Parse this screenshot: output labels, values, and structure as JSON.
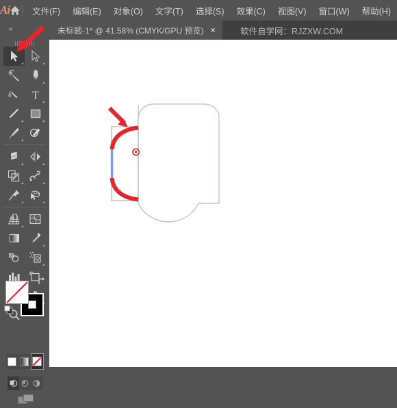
{
  "app": {
    "logo_text": "Ai",
    "home_icon": "home-icon"
  },
  "menubar": {
    "items": [
      {
        "label": "文件(F)",
        "name": "menu-file"
      },
      {
        "label": "编辑(E)",
        "name": "menu-edit"
      },
      {
        "label": "对象(O)",
        "name": "menu-object"
      },
      {
        "label": "文字(T)",
        "name": "menu-type"
      },
      {
        "label": "选择(S)",
        "name": "menu-select"
      },
      {
        "label": "效果(C)",
        "name": "menu-effect"
      },
      {
        "label": "视图(V)",
        "name": "menu-view"
      },
      {
        "label": "窗口(W)",
        "name": "menu-window"
      },
      {
        "label": "帮助(H)",
        "name": "menu-help"
      }
    ]
  },
  "tabbar": {
    "collapse_icon": "«",
    "tab_title": "未标题-1* @ 41.58% (CMYK/GPU 预览)",
    "close_label": "×",
    "watermark": "软件自学网：RJZXW.COM"
  },
  "toolpanel": {
    "tools": [
      {
        "label": "选择工具",
        "name": "tool-selection",
        "icon": "selection-arrow-icon",
        "active": true,
        "has_flyout": true
      },
      {
        "label": "直接选择工具",
        "name": "tool-direct-selection",
        "icon": "direct-selection-arrow-icon",
        "active": false,
        "has_flyout": true
      },
      {
        "label": "魔棒工具",
        "name": "tool-magic-wand",
        "icon": "magic-wand-icon",
        "active": false,
        "has_flyout": false
      },
      {
        "label": "钢笔工具",
        "name": "tool-pen",
        "icon": "pen-icon",
        "active": false,
        "has_flyout": true
      },
      {
        "label": "曲率工具",
        "name": "tool-curvature",
        "icon": "curvature-icon",
        "active": false,
        "has_flyout": false
      },
      {
        "label": "文字工具",
        "name": "tool-type",
        "icon": "type-t-icon",
        "active": false,
        "has_flyout": true
      },
      {
        "label": "直线段工具",
        "name": "tool-line-segment",
        "icon": "line-segment-icon",
        "active": false,
        "has_flyout": true
      },
      {
        "label": "矩形工具",
        "name": "tool-rectangle",
        "icon": "rectangle-icon",
        "active": false,
        "has_flyout": true
      },
      {
        "label": "画笔工具",
        "name": "tool-paintbrush",
        "icon": "paintbrush-icon",
        "active": false,
        "has_flyout": true
      },
      {
        "label": "斑点画笔工具",
        "name": "tool-blob-brush",
        "icon": "blob-brush-icon",
        "active": false,
        "has_flyout": false
      },
      {
        "label": "橡皮擦工具",
        "name": "tool-eraser",
        "icon": "eraser-icon",
        "active": false,
        "has_flyout": true
      },
      {
        "label": "旋转工具",
        "name": "tool-rotate-reflect",
        "icon": "reflect-icon",
        "active": false,
        "has_flyout": true
      },
      {
        "label": "比例缩放工具",
        "name": "tool-scale",
        "icon": "scale-icon",
        "active": false,
        "has_flyout": true
      },
      {
        "label": "宽度工具",
        "name": "tool-width-warp",
        "icon": "warp-icon",
        "active": false,
        "has_flyout": true
      },
      {
        "label": "自由变换工具",
        "name": "tool-free-transform",
        "icon": "free-transform-pin-icon",
        "active": false,
        "has_flyout": true
      },
      {
        "label": "形状生成器工具",
        "name": "tool-shape-builder",
        "icon": "shape-builder-icon",
        "active": false,
        "has_flyout": true
      },
      {
        "label": "透视网格工具",
        "name": "tool-perspective-grid",
        "icon": "perspective-grid-icon",
        "active": false,
        "has_flyout": true
      },
      {
        "label": "网格工具",
        "name": "tool-mesh",
        "icon": "mesh-icon",
        "active": false,
        "has_flyout": false
      },
      {
        "label": "渐变工具",
        "name": "tool-gradient",
        "icon": "gradient-icon",
        "active": false,
        "has_flyout": false
      },
      {
        "label": "吸管工具",
        "name": "tool-eyedropper",
        "icon": "eyedropper-icon",
        "active": false,
        "has_flyout": true
      },
      {
        "label": "混合工具",
        "name": "tool-blend",
        "icon": "blend-icon",
        "active": false,
        "has_flyout": false
      },
      {
        "label": "符号喷枪工具",
        "name": "tool-symbol-sprayer",
        "icon": "symbol-sprayer-icon",
        "active": false,
        "has_flyout": true
      },
      {
        "label": "柱形图工具",
        "name": "tool-column-graph",
        "icon": "column-graph-icon",
        "active": false,
        "has_flyout": true
      },
      {
        "label": "画板工具",
        "name": "tool-artboard",
        "icon": "artboard-icon",
        "active": false,
        "has_flyout": false
      },
      {
        "label": "切片工具",
        "name": "tool-slice",
        "icon": "slice-knife-icon",
        "active": false,
        "has_flyout": true
      },
      {
        "label": "抓手工具",
        "name": "tool-hand",
        "icon": "hand-icon",
        "active": false,
        "has_flyout": true
      },
      {
        "label": "缩放工具",
        "name": "tool-zoom",
        "icon": "magnifier-icon",
        "active": false,
        "has_flyout": false
      }
    ],
    "fill_label": "无填色",
    "stroke_label": "黑色描边",
    "swap_label": "↰",
    "color_modes": [
      {
        "label": "颜色",
        "name": "color-mode-color",
        "selected": false
      },
      {
        "label": "渐变",
        "name": "color-mode-gradient",
        "selected": false
      },
      {
        "label": "无",
        "name": "color-mode-none",
        "selected": true
      }
    ],
    "draw_modes": [
      {
        "label": "正常绘图",
        "name": "draw-mode-normal",
        "selected": true
      },
      {
        "label": "背面绘图",
        "name": "draw-mode-behind",
        "selected": false
      },
      {
        "label": "内部绘图",
        "name": "draw-mode-inside",
        "selected": false
      }
    ],
    "screen_mode_label": "更改屏幕模式"
  },
  "canvas": {
    "background_color": "#ffffff",
    "artwork": {
      "mug_body_label": "杯身路径",
      "handle_label": "杯柄圆弧路径",
      "handle_color": "#e8242c",
      "blue_segment_color": "#7b9ce8",
      "bounding_box_color": "#b0b0b0",
      "path_outline_color": "#b8b8b8",
      "anchor_point_label": "锚点",
      "anchor_point_color": "#e8242c",
      "annotation_arrow_label": "红色指示箭头",
      "annotation_arrow_color": "#e8242c"
    }
  }
}
